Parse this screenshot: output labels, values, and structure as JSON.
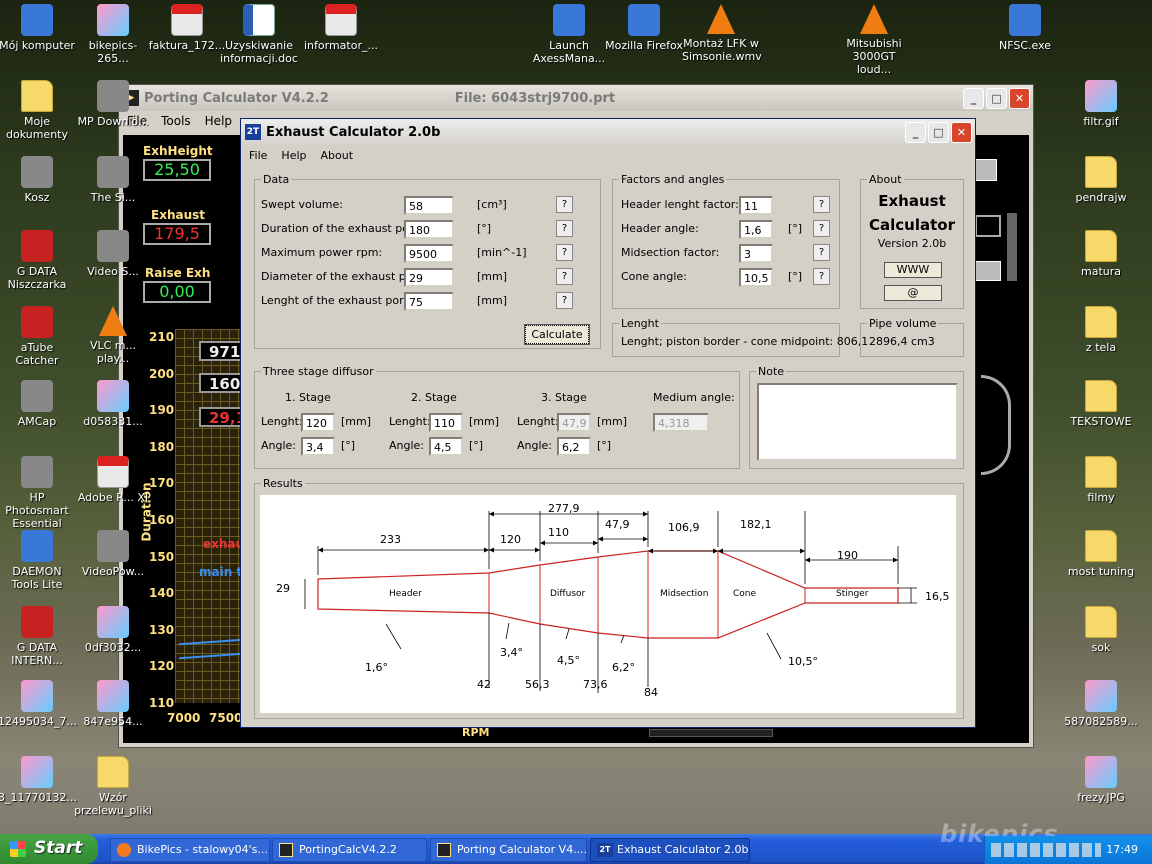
{
  "desktop": {
    "icons_left": [
      {
        "label": "Mój komputer",
        "icon": "computer-icon"
      },
      {
        "label": "Moje dokumenty",
        "icon": "documents-folder-icon"
      },
      {
        "label": "Kosz",
        "icon": "recycle-bin-icon"
      },
      {
        "label": "G DATA Niszczarka",
        "icon": "shredder-icon"
      },
      {
        "label": "aTube Catcher",
        "icon": "atube-icon"
      },
      {
        "label": "AMCap",
        "icon": "amcap-icon"
      },
      {
        "label": "HP Photosmart Essential",
        "icon": "photosmart-icon"
      },
      {
        "label": "DAEMON Tools Lite",
        "icon": "daemon-tools-icon"
      },
      {
        "label": "G DATA INTERN...",
        "icon": "gdata-shield-icon"
      },
      {
        "label": "12495034_7...",
        "icon": "image-file-icon"
      },
      {
        "label": "3_11770132...",
        "icon": "image-file-icon"
      }
    ],
    "icons_col2": [
      {
        "label": "bikepics-265...",
        "icon": "image-file-icon"
      },
      {
        "label": "MP Downlo...",
        "icon": "downloader-icon"
      },
      {
        "label": "The Si...",
        "icon": "app-icon"
      },
      {
        "label": "Video S...",
        "icon": "video-icon"
      },
      {
        "label": "VLC m... play...",
        "icon": "vlc-icon"
      },
      {
        "label": "d058331...",
        "icon": "image-file-icon"
      },
      {
        "label": "Adobe R... XI",
        "icon": "pdf-icon"
      },
      {
        "label": "VideoPow...",
        "icon": "video-icon"
      },
      {
        "label": "0df3032...",
        "icon": "image-file-icon"
      },
      {
        "label": "847e954...",
        "icon": "image-file-icon"
      },
      {
        "label": "Wzór przelewu_pliki",
        "icon": "folder-icon"
      }
    ],
    "icons_top": [
      {
        "label": "faktura_172...",
        "icon": "pdf-icon"
      },
      {
        "label": "Uzyskiwanie informacji.doc",
        "icon": "word-doc-icon"
      },
      {
        "label": "informator_...",
        "icon": "pdf-icon"
      },
      {
        "label": "Launch AxessMana...",
        "icon": "launch-icon"
      },
      {
        "label": "Mozilla Firefox",
        "icon": "firefox-icon"
      },
      {
        "label": "Montaż LFK w Simsonie.wmv",
        "icon": "vlc-cone-icon"
      },
      {
        "label": "Mitsubishi 3000GT loud...",
        "icon": "vlc-cone-icon"
      },
      {
        "label": "NFSC.exe",
        "icon": "nfs-icon"
      }
    ],
    "icons_right": [
      {
        "label": "filtr.gif",
        "icon": "image-file-icon"
      },
      {
        "label": "pendrajw",
        "icon": "folder-icon"
      },
      {
        "label": "matura",
        "icon": "folder-icon"
      },
      {
        "label": "z tela",
        "icon": "folder-icon"
      },
      {
        "label": "TEKSTOWE",
        "icon": "folder-icon"
      },
      {
        "label": "filmy",
        "icon": "folder-icon"
      },
      {
        "label": "most tuning",
        "icon": "folder-icon"
      },
      {
        "label": "sok",
        "icon": "folder-icon"
      },
      {
        "label": "587082589...",
        "icon": "image-file-icon"
      },
      {
        "label": "frezy.JPG",
        "icon": "image-file-icon"
      }
    ]
  },
  "porting": {
    "title": "Porting Calculator V4.2.2",
    "file": "File: 6043strj9700.prt",
    "menu": [
      "File",
      "Tools",
      "Help"
    ],
    "exh_height_label": "ExhHeight",
    "exh_height_value": "25,50",
    "exhaust_label": "Exhaust",
    "exhaust_value": "179,5",
    "raise_label": "Raise Exh",
    "raise_value": "0,00",
    "readouts": [
      "971",
      "160",
      "29,1"
    ],
    "y_ticks": [
      "210",
      "200",
      "190",
      "180",
      "170",
      "160",
      "150",
      "140",
      "130",
      "120",
      "110"
    ],
    "y_axis_title": "Duration",
    "x_ticks": [
      "7000",
      "7500"
    ],
    "x_axis_title": "RPM",
    "legend_exhaust": "exhau",
    "legend_main": "main t",
    "colors": {
      "panel": "#000000",
      "yellow": "#ffe082",
      "red": "#ee3333",
      "green": "#33ee55"
    }
  },
  "exhaust": {
    "title": "Exhaust Calculator 2.0b",
    "menu": [
      "File",
      "Help",
      "About"
    ],
    "data_legend": "Data",
    "data_rows": [
      {
        "label": "Swept volume:",
        "value": "58",
        "unit": "[cm³]"
      },
      {
        "label": "Duration of the exhaust port:",
        "value": "180",
        "unit": "[°]"
      },
      {
        "label": "Maximum power rpm:",
        "value": "9500",
        "unit": "[min^-1]"
      },
      {
        "label": "Diameter of the exhaust port:",
        "value": "29",
        "unit": "[mm]"
      },
      {
        "label": "Lenght of the exhaust port:",
        "value": "75",
        "unit": "[mm]"
      }
    ],
    "help_label": "?",
    "calculate_label": "Calculate",
    "factors_legend": "Factors and angles",
    "factor_rows": [
      {
        "label": "Header lenght factor:",
        "value": "11",
        "unit": ""
      },
      {
        "label": "Header angle:",
        "value": "1,6",
        "unit": "[°]"
      },
      {
        "label": "Midsection factor:",
        "value": "3",
        "unit": ""
      },
      {
        "label": "Cone angle:",
        "value": "10,5",
        "unit": "[°]"
      }
    ],
    "about_legend": "About",
    "about_title": "Exhaust Calculator",
    "about_version": "Version 2.0b",
    "www_label": "WWW",
    "email_label": "@",
    "lenght_legend": "Lenght",
    "lenght_text": "Lenght; piston border - cone midpoint:  806,1",
    "pipe_legend": "Pipe volume",
    "pipe_value": "2896,4 cm3",
    "diffusor_legend": "Three stage diffusor",
    "stage_titles": [
      "1. Stage",
      "2. Stage",
      "3. Stage"
    ],
    "medium_angle_title": "Medium angle:",
    "lenght_lbl": "Lenght:",
    "angle_lbl": "Angle:",
    "mm_lbl": "[mm]",
    "deg_lbl": "[°]",
    "stages": [
      {
        "lenght": "120",
        "angle": "3,4"
      },
      {
        "lenght": "110",
        "angle": "4,5"
      },
      {
        "lenght": "47,9",
        "angle": "6,2"
      }
    ],
    "medium_angle_value": "4,318",
    "note_legend": "Note",
    "results_legend": "Results",
    "diagram": {
      "top_dims": [
        "233",
        "120",
        "110",
        "47,9",
        "106,9",
        "182,1",
        "190"
      ],
      "total_dim": "277,9",
      "inlet_diameter": "29",
      "outlet_diameter": "16,5",
      "section_names": [
        "Header",
        "Diffusor",
        "Midsection",
        "Cone",
        "Stinger"
      ],
      "angles": [
        "1,6°",
        "3,4°",
        "4,5°",
        "6,2°",
        "10,5°"
      ],
      "positions": [
        "42",
        "56,3",
        "73,6",
        "84"
      ],
      "colors": {
        "pipe": "#cc2222",
        "dim": "#000000"
      }
    }
  },
  "taskbar": {
    "start": "Start",
    "tasks": [
      "BikePics - stalowy04's...",
      "PortingCalcV4.2.2",
      "Porting Calculator V4....",
      "Exhaust Calculator 2.0b"
    ],
    "clock": "17:49",
    "watermark": "bikepics"
  }
}
